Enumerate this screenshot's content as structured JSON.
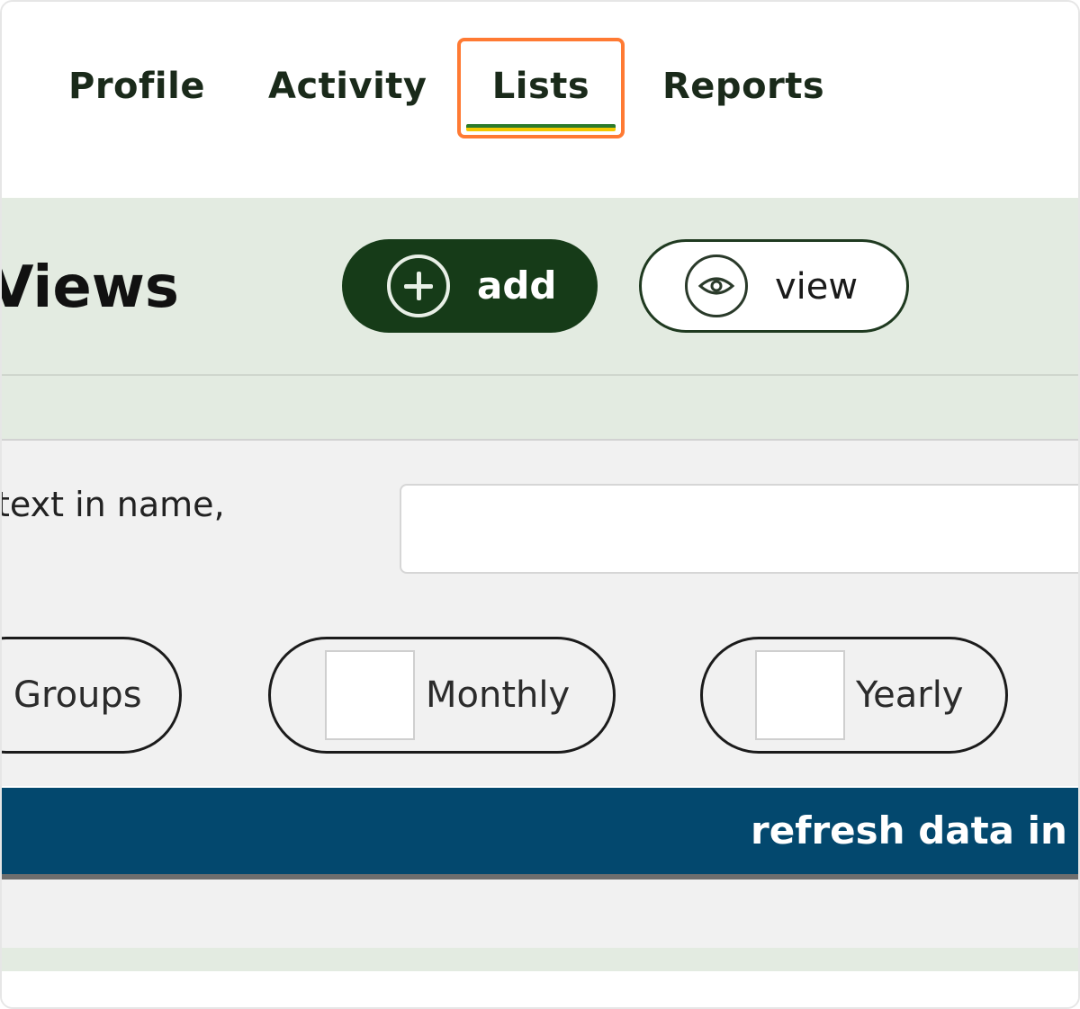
{
  "tabs": [
    {
      "label": "Profile",
      "active": false
    },
    {
      "label": "Activity",
      "active": false
    },
    {
      "label": "Lists",
      "active": true
    },
    {
      "label": "Reports",
      "active": false
    }
  ],
  "views": {
    "title": "Views",
    "add_label": "add",
    "view_label": "view"
  },
  "search": {
    "label": "text in name,",
    "value": ""
  },
  "filters": [
    {
      "label": "Groups",
      "checked": false
    },
    {
      "label": "Monthly",
      "checked": false
    },
    {
      "label": "Yearly",
      "checked": false
    }
  ],
  "refresh": {
    "label": "refresh data in ta"
  },
  "colors": {
    "highlight": "#ff7a33",
    "add_button": "#163b18",
    "band": "#e3ebe1",
    "refresh_bar": "#03486e"
  }
}
